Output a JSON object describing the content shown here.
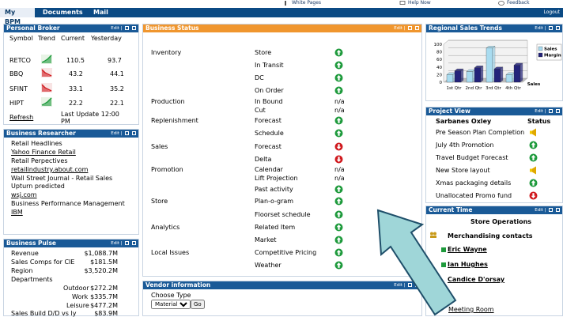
{
  "toplinks": {
    "white_pages": "White Pages",
    "help_now": "Help Now",
    "feedback": "Feedback"
  },
  "tabs": {
    "my_bpm": "My BPM",
    "documents": "Documents",
    "mail": "Mail",
    "logout": "Logout"
  },
  "panel_ctl": {
    "edit": "Edit"
  },
  "broker": {
    "title": "Personal Broker",
    "headers": [
      "Symbol",
      "Trend",
      "Current",
      "Yesterday"
    ],
    "rows": [
      {
        "symbol": "RETCO",
        "current": "110.5",
        "yesterday": "93.7",
        "trend": "up"
      },
      {
        "symbol": "BBQ",
        "current": "43.2",
        "yesterday": "44.1",
        "trend": "down"
      },
      {
        "symbol": "SFINT",
        "current": "33.1",
        "yesterday": "35.2",
        "trend": "down"
      },
      {
        "symbol": "HIPT",
        "current": "22.2",
        "yesterday": "22.1",
        "trend": "up"
      }
    ],
    "refresh": "Refresh",
    "last_update_1": "Last Update 12:00",
    "last_update_2": "PM"
  },
  "researcher": {
    "title": "Business Researcher",
    "items": [
      "Retail Headlines",
      "Yahoo Finance Retail",
      "Retail Perpectives",
      "retailindustry.about.com",
      "Wall Street Journal - Retail Sales",
      "Upturn predicted",
      "wsj.com",
      "Business Performance Management",
      "IBM"
    ]
  },
  "pulse": {
    "title": "Business Pulse",
    "rows": [
      {
        "label": "Revenue",
        "value": "$1,088.7M"
      },
      {
        "label": "Sales Comps for CIE",
        "value": "$181.5M"
      },
      {
        "label": "Region",
        "value": "$3,520.2M"
      },
      {
        "label": "Departments",
        "value": ""
      },
      {
        "label": "Outdoor",
        "value": "$272.2M"
      },
      {
        "label": "Work",
        "value": "$335.7M"
      },
      {
        "label": "Leisure",
        "value": "$477.2M"
      },
      {
        "label": "Sales Build D/D vs ly",
        "value": "$83.9M"
      }
    ]
  },
  "status": {
    "title": "Business Status",
    "groups": [
      {
        "name": "Inventory",
        "items": [
          {
            "label": "Store",
            "state": "green"
          },
          {
            "label": "In Transit",
            "state": "green"
          },
          {
            "label": "DC",
            "state": "green"
          },
          {
            "label": "On Order",
            "state": "green"
          }
        ]
      },
      {
        "name": "Production",
        "items": [
          {
            "label": "In Bound",
            "value": "n/a"
          },
          {
            "label": "Cut",
            "value": "n/a"
          }
        ]
      },
      {
        "name": "Replenishment",
        "items": [
          {
            "label": "Forecast",
            "state": "green"
          },
          {
            "label": "Schedule",
            "state": "green"
          }
        ]
      },
      {
        "name": "Sales",
        "items": [
          {
            "label": "Forecast",
            "state": "red"
          },
          {
            "label": "Delta",
            "state": "red"
          }
        ]
      },
      {
        "name": "Promotion",
        "items": [
          {
            "label": "Calendar",
            "value": "n/a"
          },
          {
            "label": "Lift Projection",
            "value": "n/a"
          },
          {
            "label": "Past activity",
            "state": "green"
          }
        ]
      },
      {
        "name": "Store",
        "items": [
          {
            "label": "Plan-o-gram",
            "state": "green"
          },
          {
            "label": "Floorset schedule",
            "state": "green"
          }
        ]
      },
      {
        "name": "Analytics",
        "items": [
          {
            "label": "Related Item",
            "state": "green"
          },
          {
            "label": "Market",
            "state": "green"
          }
        ]
      },
      {
        "name": "Local Issues",
        "items": [
          {
            "label": "Competitive Pricing",
            "state": "green"
          },
          {
            "label": "Weather",
            "state": "green"
          }
        ]
      }
    ]
  },
  "vendor": {
    "title": "Vendor information",
    "choose_type": "Choose Type",
    "selected": "Materials",
    "go": "Go"
  },
  "trends": {
    "title": "Regional Sales Trends"
  },
  "chart_data": {
    "type": "bar",
    "categories": [
      "1st Qtr",
      "2nd Qtr",
      "3rd Qtr",
      "4th Qtr"
    ],
    "series": [
      {
        "name": "Sales",
        "values": [
          20,
          28,
          90,
          20
        ],
        "color": "#a9dcf0"
      },
      {
        "name": "Margin",
        "values": [
          30,
          38,
          35,
          45
        ],
        "color": "#23237a"
      }
    ],
    "yticks": [
      "0",
      "20",
      "40",
      "60",
      "80",
      "100"
    ],
    "ylim": [
      0,
      100
    ],
    "xlabel": "Sales",
    "legend": "right"
  },
  "project": {
    "title": "Project View",
    "header_name": "Sarbanes Oxley",
    "header_status": "Status",
    "rows": [
      {
        "label": "Pre Season Plan Completion",
        "state": "warn"
      },
      {
        "label": "July 4th Promotion",
        "state": "green"
      },
      {
        "label": "Travel Budget Forecast",
        "state": "green"
      },
      {
        "label": "New Store layout",
        "state": "warn"
      },
      {
        "label": "Xmas packaging details",
        "state": "green"
      },
      {
        "label": "Unallocated Promo fund",
        "state": "red"
      }
    ]
  },
  "current_time": {
    "title": "Current Time",
    "store_ops": "Store Operations",
    "merch": "Merchandising contacts",
    "contacts": [
      "Eric Wayne",
      "Ian Hughes",
      "Candice D'orsay"
    ],
    "meeting": "Meeting Room"
  },
  "colors": {
    "nav": "#0b4a84",
    "panel_header": "#1a5a97",
    "status_header": "#f0962e",
    "ok": "#1e9a3c",
    "alert": "#d0191e",
    "warn": "#f0c800",
    "arrow": "#9fd6d8"
  }
}
